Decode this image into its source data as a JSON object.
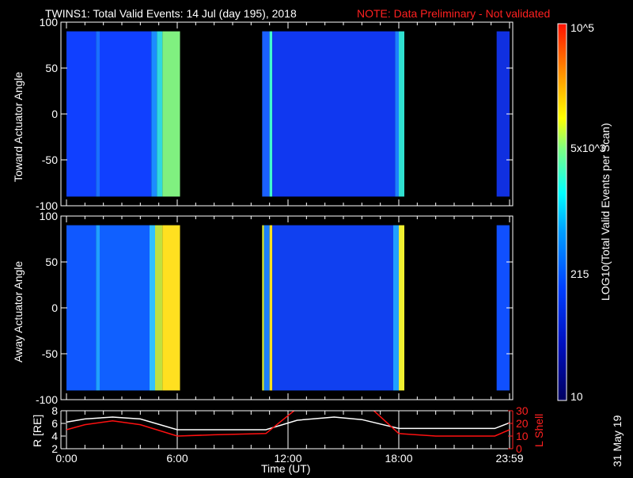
{
  "title": "TWINS1: Total Valid Events: 14 Jul (day 195), 2018",
  "note": "NOTE: Data Preliminary - Not validated",
  "date_stamp": "31 May 19",
  "chart_data": [
    {
      "type": "heatmap",
      "name": "toward",
      "ylabel": "Toward Actuator Angle",
      "ylim": [
        -100,
        100
      ],
      "yticks": [
        "100",
        "50",
        "0",
        "-50",
        "-100"
      ],
      "angle_range": [
        -90,
        90
      ],
      "segments": [
        {
          "start": 0,
          "end": 6.15,
          "bands": [
            [
              0,
              1.6,
              "#1040ff"
            ],
            [
              1.6,
              1.8,
              "#1a70ff"
            ],
            [
              1.8,
              4.6,
              "#1040ff"
            ],
            [
              4.6,
              4.9,
              "#1c8cff"
            ],
            [
              4.9,
              5.2,
              "#30d8e0"
            ],
            [
              5.2,
              6.15,
              "#80f080"
            ]
          ]
        },
        {
          "start": 10.6,
          "end": 18.3,
          "bands": [
            [
              10.6,
              11.0,
              "#1a60ff"
            ],
            [
              11.0,
              11.15,
              "#40ffd0"
            ],
            [
              11.15,
              17.8,
              "#1038f0"
            ],
            [
              17.8,
              18.0,
              "#1c80ff"
            ],
            [
              18.0,
              18.3,
              "#30e0d0"
            ]
          ]
        },
        {
          "start": 23.3,
          "end": 24,
          "bands": [
            [
              23.3,
              24,
              "#1030e0"
            ]
          ]
        }
      ]
    },
    {
      "type": "heatmap",
      "name": "away",
      "ylabel": "Away Actuator Angle",
      "ylim": [
        -100,
        100
      ],
      "yticks": [
        "100",
        "50",
        "0",
        "-50",
        "-100"
      ],
      "angle_range": [
        -90,
        90
      ],
      "segments": [
        {
          "start": 0,
          "end": 6.15,
          "bands": [
            [
              0,
              1.6,
              "#1058ff"
            ],
            [
              1.6,
              1.8,
              "#20a0ff"
            ],
            [
              1.8,
              4.5,
              "#1060ff"
            ],
            [
              4.5,
              4.8,
              "#30c0ff"
            ],
            [
              4.8,
              5.2,
              "#c0e040"
            ],
            [
              5.2,
              6.15,
              "#ffe020"
            ]
          ]
        },
        {
          "start": 10.6,
          "end": 18.3,
          "bands": [
            [
              10.6,
              10.7,
              "#e0f030"
            ],
            [
              10.7,
              11.0,
              "#1c80ff"
            ],
            [
              11.0,
              11.15,
              "#ffe020"
            ],
            [
              11.15,
              17.7,
              "#1040f0"
            ],
            [
              17.7,
              18.0,
              "#20a0ff"
            ],
            [
              18.0,
              18.3,
              "#f0f030"
            ]
          ]
        },
        {
          "start": 23.3,
          "end": 24,
          "bands": [
            [
              23.3,
              24,
              "#1050ff"
            ]
          ]
        }
      ]
    },
    {
      "type": "line",
      "ylabel": "R [RE]",
      "y2label": "L Shell",
      "xlabel": "Time (UT)",
      "xlim": [
        0,
        24
      ],
      "ylim": [
        2,
        8
      ],
      "y2lim": [
        0,
        30
      ],
      "yticks": [
        "8",
        "6",
        "4",
        "2"
      ],
      "y2ticks": [
        "30",
        "20",
        "10",
        "0"
      ],
      "xticks": [
        "0:00",
        "6:00",
        "12:00",
        "18:00",
        "23:59"
      ],
      "series": [
        {
          "name": "R",
          "color": "#ffffff",
          "x": [
            0,
            1,
            2.5,
            4,
            6,
            10.8,
            12.5,
            14.5,
            16,
            18,
            23.2,
            24
          ],
          "y": [
            6.2,
            6.7,
            7.0,
            6.7,
            5.0,
            5.0,
            6.5,
            7.0,
            6.6,
            5.2,
            5.2,
            6.1
          ]
        },
        {
          "name": "L Shell",
          "color": "#ff1010",
          "x": [
            0,
            1,
            2.5,
            4,
            6,
            8,
            10.8,
            12.5,
            16.5,
            18,
            20,
            23.2,
            24
          ],
          "y": [
            15,
            19,
            22,
            19,
            10,
            11,
            12,
            32,
            32,
            12,
            10,
            10,
            15
          ]
        }
      ]
    },
    {
      "type": "colorbar",
      "label": "LOG10(Total Valid Events per Scan)",
      "ticks": [
        "10^5",
        "5x10^3",
        "215",
        "10"
      ]
    }
  ]
}
